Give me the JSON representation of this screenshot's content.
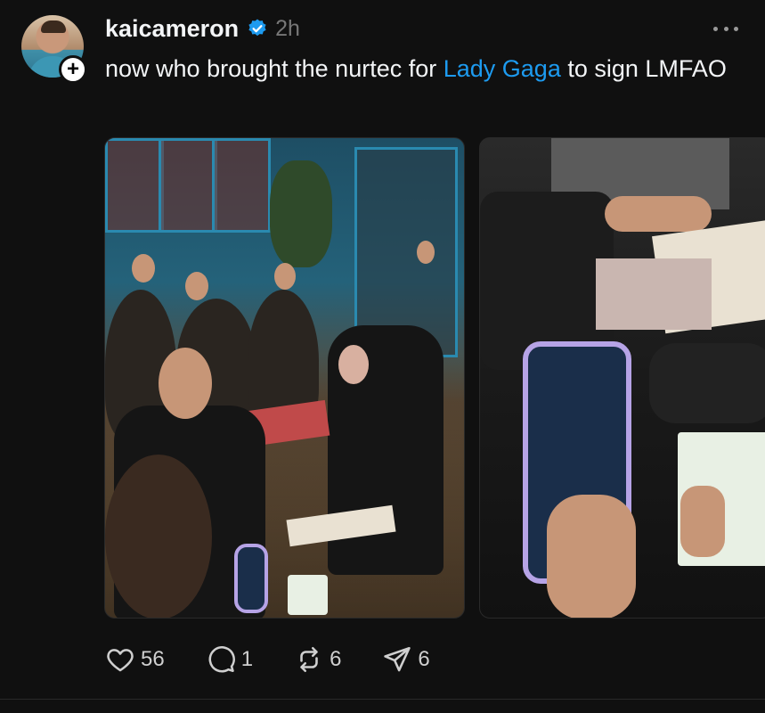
{
  "post": {
    "username": "kaicameron",
    "time": "2h",
    "text_before": "now who brought the nurtec for ",
    "mention": "Lady Gaga",
    "text_after": " to sign LMFAO",
    "follow_symbol": "+"
  },
  "icons": {
    "verified": "verified-badge-icon",
    "more": "more-options-icon",
    "like": "heart-icon",
    "reply": "comment-bubble-icon",
    "repost": "repost-icon",
    "share": "send-icon"
  },
  "actions": {
    "likes": "56",
    "replies": "1",
    "reposts": "6",
    "shares": "6"
  },
  "colors": {
    "background": "#101010",
    "mention": "#1d9bf0",
    "verified": "#1d9bf0",
    "muted": "#777777"
  }
}
